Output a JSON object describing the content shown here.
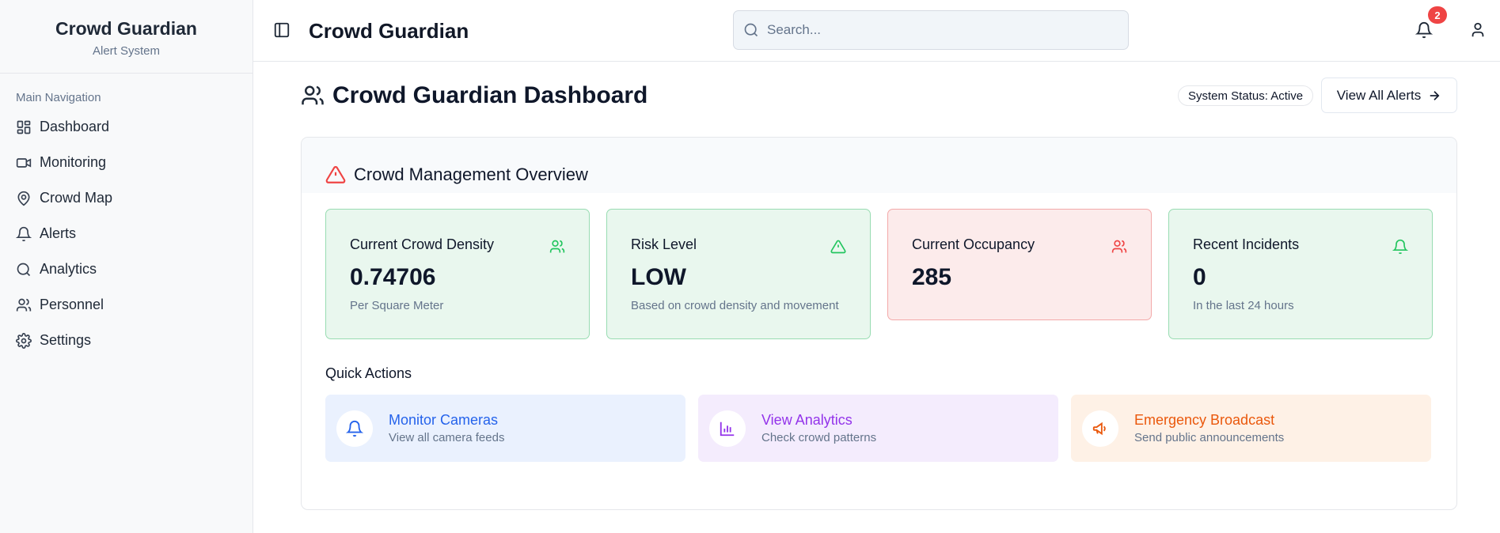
{
  "sidebar": {
    "brand_title": "Crowd Guardian",
    "brand_subtitle": "Alert System",
    "group_label": "Main Navigation",
    "items": [
      {
        "label": "Dashboard",
        "icon": "dashboard-grid-icon"
      },
      {
        "label": "Monitoring",
        "icon": "video-camera-icon"
      },
      {
        "label": "Crowd Map",
        "icon": "map-pin-icon"
      },
      {
        "label": "Alerts",
        "icon": "bell-icon"
      },
      {
        "label": "Analytics",
        "icon": "search-icon"
      },
      {
        "label": "Personnel",
        "icon": "users-icon"
      },
      {
        "label": "Settings",
        "icon": "gear-icon"
      }
    ]
  },
  "header": {
    "title": "Crowd Guardian",
    "search_placeholder": "Search...",
    "notification_count": "2"
  },
  "main": {
    "page_title": "Crowd Guardian Dashboard",
    "system_status": "System Status: Active",
    "view_all_alerts": "View All Alerts",
    "overview_title": "Crowd Management Overview",
    "stats": [
      {
        "label": "Current Crowd Density",
        "value": "0.74706",
        "note": "Per Square Meter",
        "tone": "green",
        "icon": "users-icon"
      },
      {
        "label": "Risk Level",
        "value": "LOW",
        "note": "Based on crowd density and movement",
        "tone": "green",
        "icon": "warning-triangle-icon"
      },
      {
        "label": "Current Occupancy",
        "value": "285",
        "note": "",
        "tone": "red",
        "icon": "users-icon"
      },
      {
        "label": "Recent Incidents",
        "value": "0",
        "note": "In the last 24 hours",
        "tone": "green",
        "icon": "bell-icon"
      }
    ],
    "quick_actions_title": "Quick Actions",
    "quick_actions": [
      {
        "title": "Monitor Cameras",
        "subtitle": "View all camera feeds",
        "color": "#2563eb",
        "icon": "bell-icon"
      },
      {
        "title": "View Analytics",
        "subtitle": "Check crowd patterns",
        "color": "#9333ea",
        "icon": "bar-chart-icon"
      },
      {
        "title": "Emergency Broadcast",
        "subtitle": "Send public announcements",
        "color": "#ea580c",
        "icon": "megaphone-icon"
      }
    ]
  },
  "colors": {
    "green_card_bg": "#e9f7ee",
    "red_card_bg": "#fcebeb",
    "alert_red": "#ef4444",
    "badge_red": "#ef4444"
  }
}
